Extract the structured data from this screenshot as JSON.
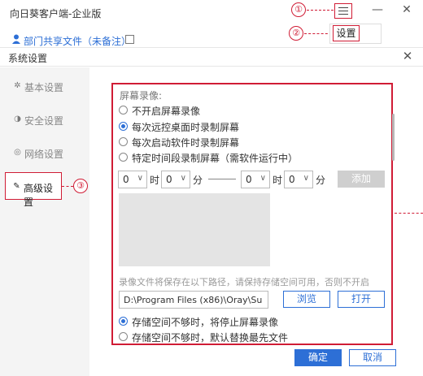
{
  "app": {
    "title": "向日葵客户端-企业版",
    "subtitle": "部门共享文件（未备注）",
    "window_controls": {
      "minimize": "—",
      "close": "✕"
    }
  },
  "annotations": {
    "step1": "①",
    "step2": "②",
    "step3": "③"
  },
  "main_menu": {
    "settings_item": "设置"
  },
  "dialog": {
    "title": "系统设置",
    "close": "✕",
    "sidebar": [
      {
        "label": "基本设置",
        "icon": "gear-icon",
        "glyph": "✲"
      },
      {
        "label": "安全设置",
        "icon": "shield-icon",
        "glyph": "◑"
      },
      {
        "label": "网络设置",
        "icon": "network-icon",
        "glyph": "◎"
      },
      {
        "label": "高级设置",
        "icon": "advanced-icon",
        "glyph": "✎"
      }
    ],
    "screen_recording": {
      "section_title": "屏幕录像:",
      "options": [
        {
          "label": "不开启屏幕录像",
          "checked": false
        },
        {
          "label": "每次远控桌面时录制屏幕",
          "checked": true
        },
        {
          "label": "每次启动软件时录制屏幕",
          "checked": false
        },
        {
          "label": "特定时间段录制屏幕（需软件运行中）",
          "checked": false
        }
      ],
      "time_range": {
        "start_hour": "0",
        "start_minute": "0",
        "end_hour": "0",
        "end_minute": "0",
        "hour_unit": "时",
        "minute_unit": "分",
        "add_button": "添加"
      },
      "path_note": "录像文件将保存在以下路径，请保持存储空间可用，否则不开启",
      "path_value": "D:\\Program Files (x86)\\Oray\\Su",
      "browse_button": "浏览",
      "open_button": "打开",
      "storage_options": [
        {
          "label": "存储空间不够时，将停止屏幕录像",
          "checked": true
        },
        {
          "label": "存储空间不够时，默认替换最先文件",
          "checked": false
        }
      ]
    },
    "ok_button": "确定",
    "cancel_button": "取消"
  },
  "colors": {
    "accent": "#2d6fd6",
    "annotation": "#d01c35",
    "disabled": "#cfcfcf"
  }
}
